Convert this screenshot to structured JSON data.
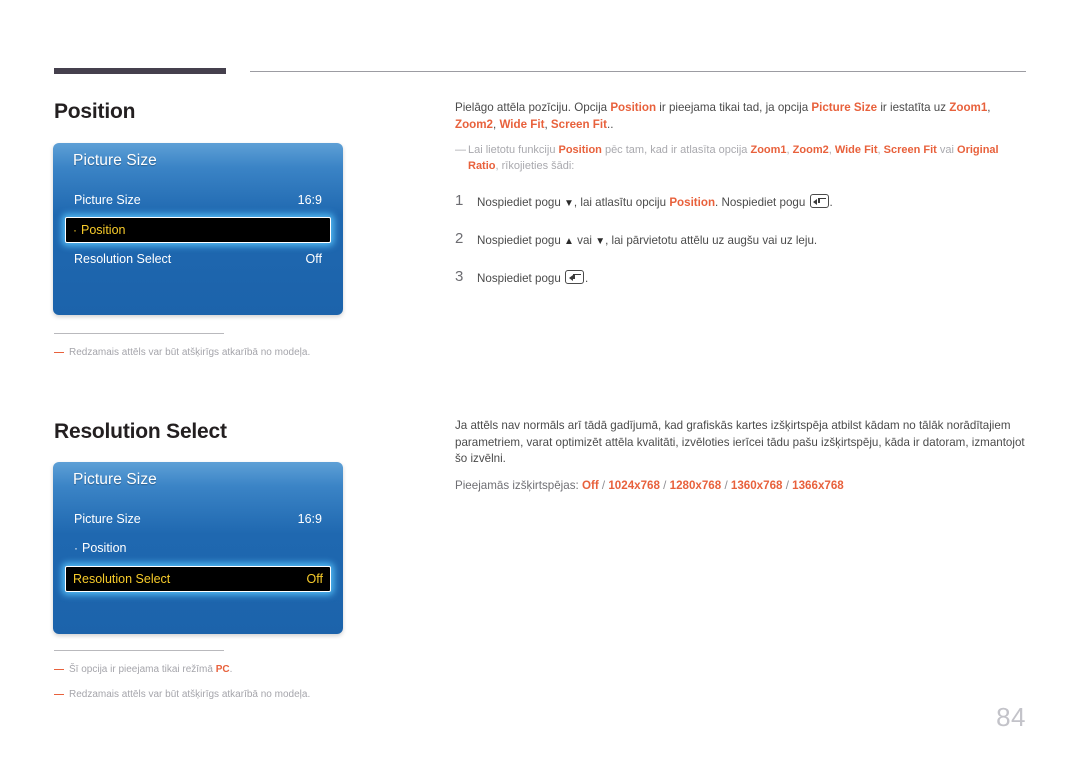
{
  "page": {
    "number": "84",
    "language": "lv"
  },
  "sections": [
    {
      "id": "position",
      "title": "Position",
      "osd": {
        "header": "Picture Size",
        "rows": [
          {
            "label": "Picture Size",
            "value": "16:9",
            "selected": false,
            "bullet": false
          },
          {
            "label": "Position",
            "value": "",
            "selected": true,
            "bullet": true
          },
          {
            "label": "Resolution Select",
            "value": "Off",
            "selected": false,
            "bullet": false
          }
        ]
      },
      "notes": [
        "Redzamais attēls var būt atšķirīgs atkarībā no modeļa."
      ],
      "body": {
        "intro_1": "Pielāgo attēla pozīciju. Opcija ",
        "intro_em1": "Position",
        "intro_2": " ir pieejama tikai tad, ja opcija ",
        "intro_em2": "Picture Size",
        "intro_3": " ir iestatīta uz ",
        "intro_em3": "Zoom1",
        "intro_4": ", ",
        "intro_em4": "Zoom2",
        "intro_5": ", ",
        "intro_em5": "Wide Fit",
        "intro_6": ", ",
        "intro_em6": "Screen Fit",
        "intro_7": ".."
      },
      "sub_note": {
        "t1": "Lai lietotu funkciju ",
        "em1": "Position",
        "t2": " pēc tam, kad ir atlasīta opcija ",
        "em2": "Zoom1",
        "t3": ", ",
        "em3": "Zoom2",
        "t4": ", ",
        "em4": "Wide Fit",
        "t5": ", ",
        "em5": "Screen Fit",
        "t6": " vai ",
        "em6": "Original Ratio",
        "t7": ", rīkojieties šādi:"
      },
      "steps": [
        {
          "num": "1",
          "t1": "Nospiediet pogu ",
          "icon1": "▼",
          "t2": ", lai atlasītu opciju ",
          "em1": "Position",
          "t3": ". Nospiediet pogu ",
          "icon2": "enter-key",
          "t4": "."
        },
        {
          "num": "2",
          "t1": "Nospiediet pogu ",
          "icon1": "▲",
          "t2": " vai ",
          "icon2": "▼",
          "t3": ", lai pārvietotu attēlu uz augšu vai uz leju.",
          "t4": ""
        },
        {
          "num": "3",
          "t1": "Nospiediet pogu ",
          "icon1": "enter-key",
          "t2": ".",
          "t3": "",
          "t4": ""
        }
      ]
    },
    {
      "id": "resolution-select",
      "title": "Resolution Select",
      "osd": {
        "header": "Picture Size",
        "rows": [
          {
            "label": "Picture Size",
            "value": "16:9",
            "selected": false,
            "bullet": false
          },
          {
            "label": "Position",
            "value": "",
            "selected": false,
            "bullet": true
          },
          {
            "label": "Resolution Select",
            "value": "Off",
            "selected": true,
            "bullet": false
          }
        ]
      },
      "notes": [
        {
          "text_pre": "Šī opcija ir pieejama tikai režīmā ",
          "em": "PC",
          "text_post": "."
        },
        {
          "text_pre": "Redzamais attēls var būt atšķirīgs atkarībā no modeļa.",
          "em": "",
          "text_post": ""
        }
      ],
      "body": {
        "paragraph": "Ja attēls nav normāls arī tādā gadījumā, kad grafiskās kartes izšķirtspēja atbilst kādam no tālāk norādītajiem parametriem, varat optimizēt attēla kvalitāti, izvēloties ierīcei tādu pašu izšķirtspēju, kāda ir datoram, izmantojot šo izvēlni."
      },
      "resolutions": {
        "label": "Pieejamās izšķirtspējas: ",
        "values": [
          "Off",
          "1024x768",
          "1280x768",
          "1360x768",
          "1366x768"
        ],
        "separator": " / "
      }
    }
  ],
  "colors": {
    "accent_orange": "#e8613c",
    "osd_blue_top": "#5ea0d6",
    "osd_blue_bottom": "#1c63ab",
    "osd_selected_text": "#f7cb2a",
    "rule_dark": "#45404d"
  }
}
